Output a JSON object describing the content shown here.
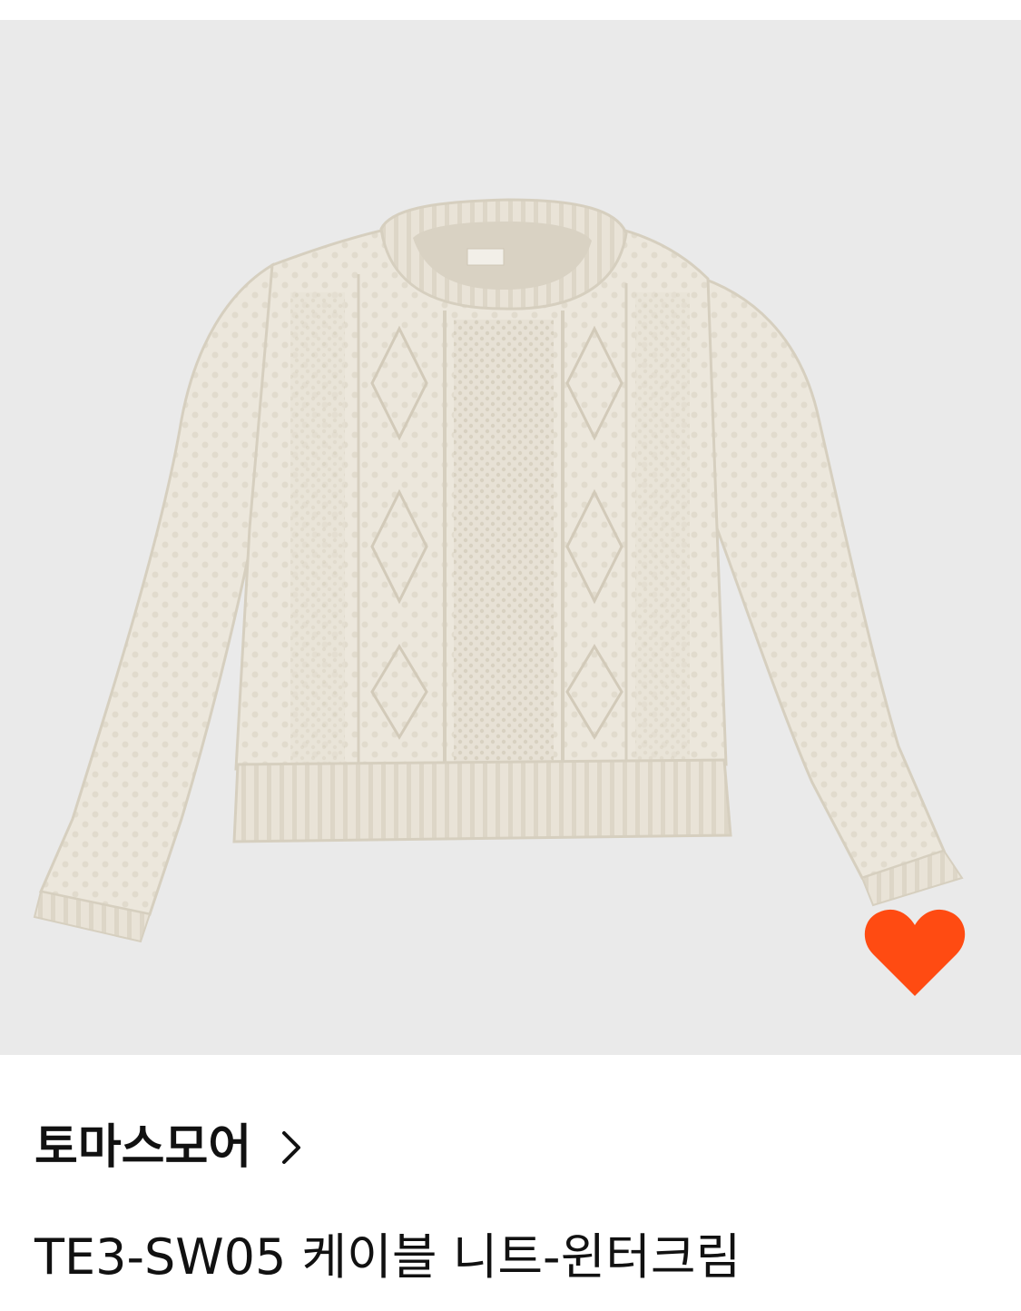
{
  "product": {
    "brand": "토마스모어",
    "name": "TE3-SW05 케이블 니트-윈터크림",
    "image_alt": "cream cable knit sweater",
    "wishlisted": true
  },
  "icons": {
    "wishlist": "heart-icon",
    "brand_link": "chevron-right-icon"
  },
  "colors": {
    "image_background": "#eaeaea",
    "heart": "#ff4b12",
    "text": "#111111",
    "sweater": "#ece7dc"
  }
}
